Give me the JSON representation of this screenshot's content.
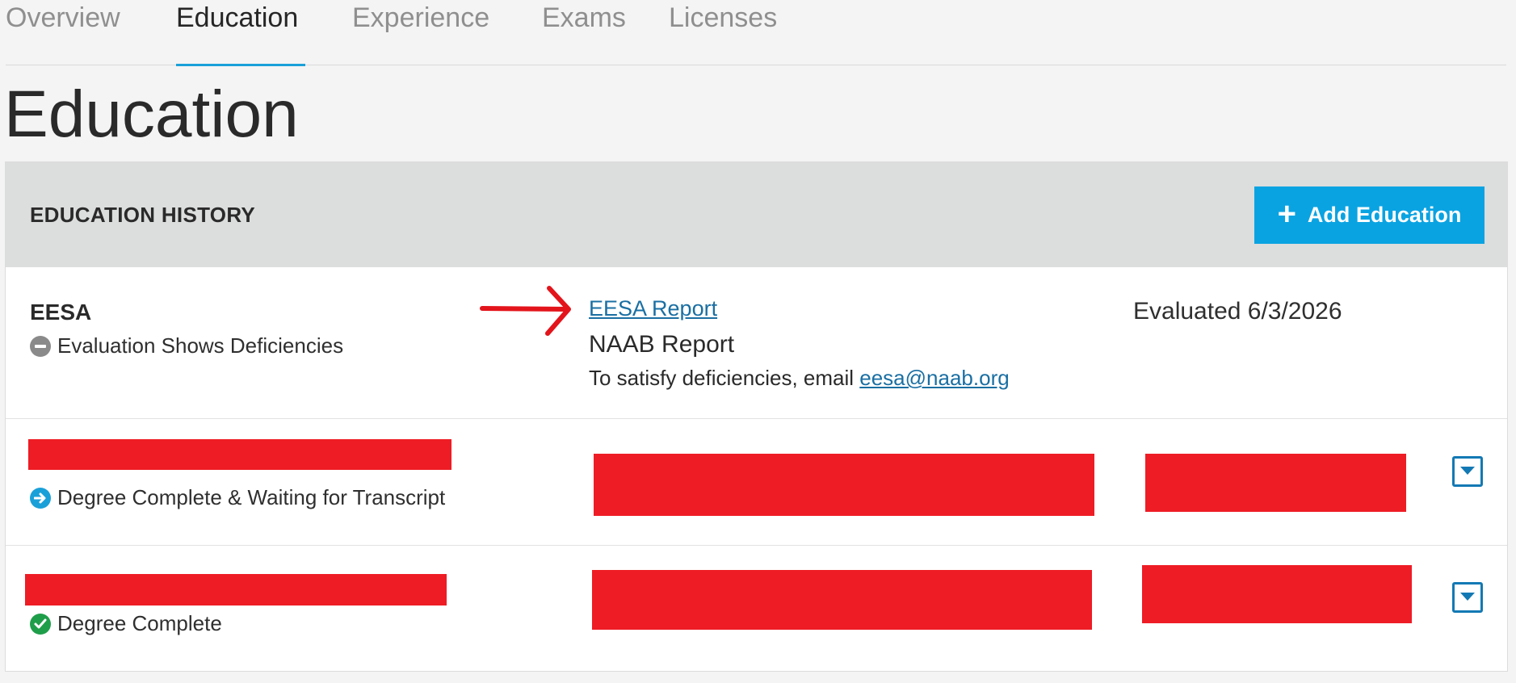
{
  "tabs": [
    {
      "label": "Overview",
      "active": false
    },
    {
      "label": "Education",
      "active": true
    },
    {
      "label": "Experience",
      "active": false
    },
    {
      "label": "Exams",
      "active": false
    },
    {
      "label": "Licenses",
      "active": false
    }
  ],
  "page_title": "Education",
  "panel": {
    "title": "EDUCATION HISTORY",
    "add_button": {
      "icon": "plus-icon",
      "label": "Add Education"
    }
  },
  "rows": [
    {
      "name": "EESA",
      "status": "Evaluation Shows Deficiencies",
      "status_icon": "minus-circle-icon",
      "report_link": "EESA Report",
      "report_source": "NAAB Report",
      "email_prefix": "To satisfy deficiencies, email",
      "email": "eesa@naab.org",
      "evaluated": "Evaluated 6/3/2026"
    },
    {
      "status": "Degree Complete & Waiting for Transcript",
      "status_icon": "arrow-right-circle-icon",
      "redacted": true
    },
    {
      "status": "Degree Complete",
      "status_icon": "check-circle-icon",
      "redacted": true
    }
  ],
  "colors": {
    "accent": "#0aa3e2",
    "link": "#1a6fa3",
    "redaction": "#ee1c25",
    "annotation_arrow": "#e3141b",
    "status_deficiency": "#8a8a8a",
    "status_waiting": "#1aa0d8",
    "status_complete": "#1f9e4a"
  }
}
